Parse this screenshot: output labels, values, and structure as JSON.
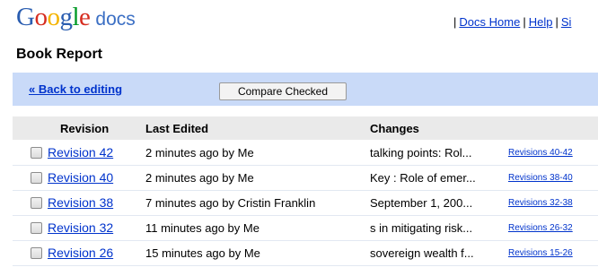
{
  "app": {
    "logo_text": "Google",
    "product_name": "docs"
  },
  "topnav": {
    "sep1": "|",
    "docs_home": "Docs Home",
    "sep2": "|",
    "help": "Help",
    "sep3": "|",
    "sign_out_partial": "Si"
  },
  "document": {
    "title": "Book Report"
  },
  "actions": {
    "back_label": "« Back to editing",
    "compare_label": "Compare Checked"
  },
  "table": {
    "columns": {
      "revision": "Revision",
      "last_edited": "Last Edited",
      "changes": "Changes"
    },
    "rows": [
      {
        "revision": "Revision 42",
        "edited": "2 minutes ago by Me",
        "changes": "talking points: Rol...",
        "range": "Revisions 40-42"
      },
      {
        "revision": "Revision 40",
        "edited": "2 minutes ago by Me",
        "changes": "Key : Role of emer...",
        "range": "Revisions 38-40"
      },
      {
        "revision": "Revision 38",
        "edited": "7 minutes ago by Cristin Franklin",
        "changes": "September 1, 200...",
        "range": "Revisions 32-38"
      },
      {
        "revision": "Revision 32",
        "edited": "11 minutes ago by Me",
        "changes": "s in mitigating risk...",
        "range": "Revisions 26-32"
      },
      {
        "revision": "Revision 26",
        "edited": "15 minutes ago by Me",
        "changes": "sovereign wealth f...",
        "range": "Revisions 15-26"
      }
    ]
  },
  "colors": {
    "action_bar": "#c9daf8",
    "header_row": "#eaeaea",
    "link": "#0033cc"
  }
}
